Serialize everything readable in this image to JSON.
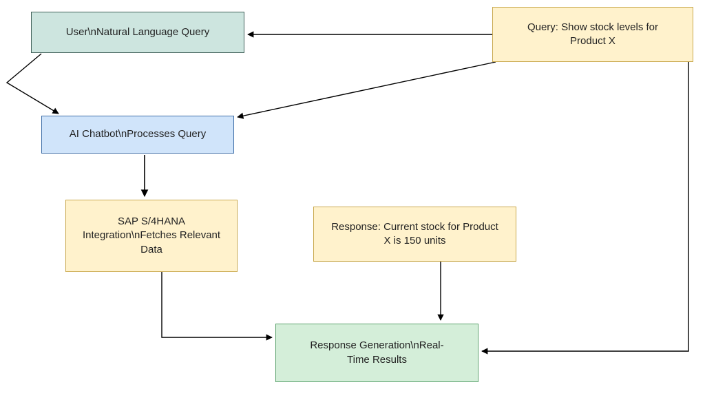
{
  "nodes": {
    "user": "User\\nNatural Language Query",
    "query": "Query: Show stock levels for\nProduct X",
    "chat": "AI Chatbot\\nProcesses Query",
    "sap": "SAP S/4HANA\nIntegration\\nFetches Relevant\nData",
    "resp": "Response: Current stock for Product\nX is 150 units",
    "gen": "Response Generation\\nReal-\nTime Results"
  },
  "colors": {
    "teal": "#CDE5DF",
    "blue": "#D0E4FA",
    "gold": "#FFF2CC",
    "green": "#D4EED9"
  },
  "edges": [
    {
      "from": "user",
      "to": "chat",
      "desc": "user-to-chatbot"
    },
    {
      "from": "query",
      "to": "user",
      "desc": "query-example-to-user"
    },
    {
      "from": "query",
      "to": "chat",
      "desc": "query-example-to-chatbot"
    },
    {
      "from": "chat",
      "to": "sap",
      "desc": "chatbot-to-sap"
    },
    {
      "from": "sap",
      "to": "gen",
      "desc": "sap-to-response-gen"
    },
    {
      "from": "resp",
      "to": "gen",
      "desc": "response-example-to-gen"
    },
    {
      "from": "query",
      "to": "gen",
      "desc": "query-example-to-gen-right"
    }
  ]
}
